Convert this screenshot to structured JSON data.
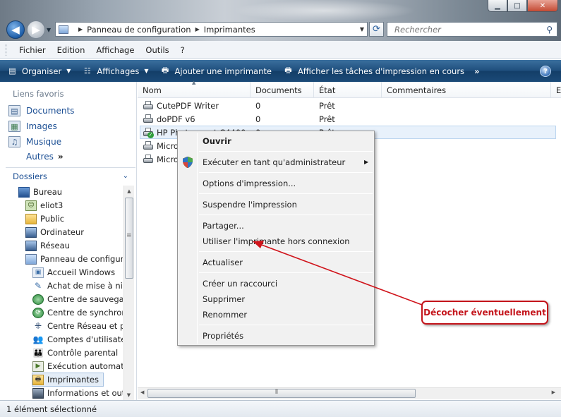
{
  "addressbar": {
    "crumbs": [
      "Panneau de configuration",
      "Imprimantes"
    ],
    "search_placeholder": "Rechercher"
  },
  "menubar": {
    "items": [
      "Fichier",
      "Edition",
      "Affichage",
      "Outils",
      "?"
    ]
  },
  "commandbar": {
    "organiser": "Organiser",
    "affichages": "Affichages",
    "ajouter": "Ajouter une imprimante",
    "afficher_taches": "Afficher les tâches d'impression en cours",
    "more": "»"
  },
  "navpane": {
    "favorites_heading": "Liens favoris",
    "favorites": [
      "Documents",
      "Images",
      "Musique"
    ],
    "autres": "Autres",
    "dossiers_label": "Dossiers",
    "tree": [
      "Bureau",
      "eliot3",
      "Public",
      "Ordinateur",
      "Réseau",
      "Panneau de configura",
      "Accueil Windows",
      "Achat de mise à nive",
      "Centre de sauvegarc",
      "Centre de synchroni",
      "Centre Réseau et par",
      "Comptes d'utilisater",
      "Contrôle parental",
      "Exécution automatic",
      "Imprimantes",
      "Informations et outi"
    ]
  },
  "filelist": {
    "columns": [
      "Nom",
      "Documents",
      "État",
      "Commentaires",
      "E"
    ],
    "rows": [
      {
        "name": "CutePDF Writer",
        "documents": "0",
        "etat": "Prêt"
      },
      {
        "name": "doPDF v6",
        "documents": "0",
        "etat": "Prêt"
      },
      {
        "name": "HP Photosmart C4400",
        "documents": "0",
        "etat": "Prêt"
      },
      {
        "name": "Micro",
        "documents": "",
        "etat": ""
      },
      {
        "name": "Micro",
        "documents": "",
        "etat": ""
      }
    ]
  },
  "context_menu": {
    "items": [
      "Ouvrir",
      "Exécuter en tant qu'administrateur",
      "Options d'impression...",
      "Suspendre l'impression",
      "Partager...",
      "Utiliser l'imprimante hors connexion",
      "Actualiser",
      "Créer un raccourci",
      "Supprimer",
      "Renommer",
      "Propriétés"
    ]
  },
  "annotation": {
    "text": "Décocher éventuellement",
    "color": "#c4141b"
  },
  "statusbar": {
    "text": "1 élément sélectionné"
  },
  "colors": {
    "commandbar": "#1f4f7d",
    "link": "#1c4f94",
    "selection": "#e8f1fb"
  }
}
